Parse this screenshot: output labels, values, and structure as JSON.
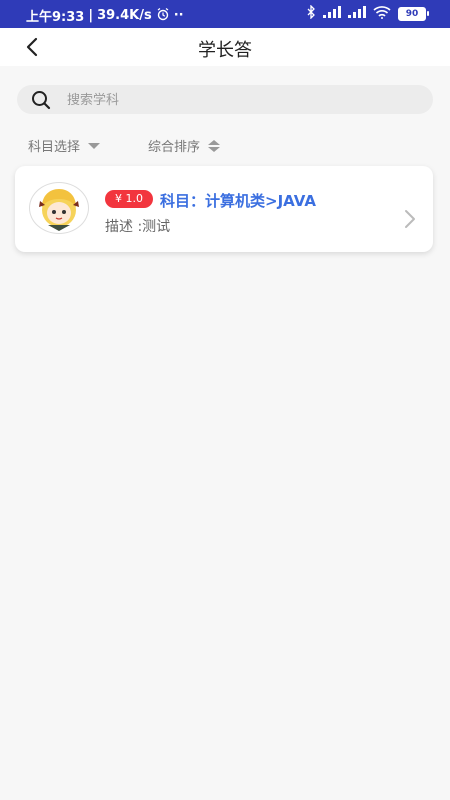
{
  "statusbar": {
    "time": "上午9:33",
    "speed": "39.4K/s",
    "battery": "90"
  },
  "header": {
    "title": "学长答"
  },
  "search": {
    "placeholder": "搜索学科",
    "value": ""
  },
  "filters": {
    "subject_label": "科目选择",
    "sort_label": "综合排序"
  },
  "list": [
    {
      "price": "¥ 1.0",
      "subject": "科目：计算机类>JAVA",
      "description": "描述 :测试"
    }
  ],
  "colors": {
    "statusbar": "#2f3bb8",
    "price_badge": "#f2353e",
    "subject_text": "#3b6fe0"
  }
}
